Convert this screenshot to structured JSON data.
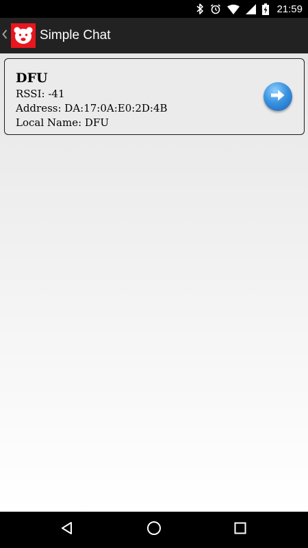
{
  "status_bar": {
    "time": "21:59",
    "icons": [
      "bluetooth-icon",
      "alarm-icon",
      "wifi-icon",
      "cell-signal-icon",
      "battery-charging-icon"
    ]
  },
  "action_bar": {
    "back_icon": "chevron-left-icon",
    "logo_icon": "bear-logo-icon",
    "title": "Simple Chat"
  },
  "devices": [
    {
      "name": "DFU",
      "rssi": "RSSI: -41",
      "address": "Address: DA:17:0A:E0:2D:4B",
      "local_name": "Local Name: DFU",
      "action_icon": "arrow-right-circle-icon"
    }
  ],
  "nav_bar": {
    "buttons": [
      "back-triangle-icon",
      "home-circle-icon",
      "recents-square-icon"
    ]
  },
  "colors": {
    "action_bar": "#222222",
    "logo_red": "#e8161e",
    "card_background": "#ebebeb",
    "connect_blue": "#3b93e0"
  }
}
